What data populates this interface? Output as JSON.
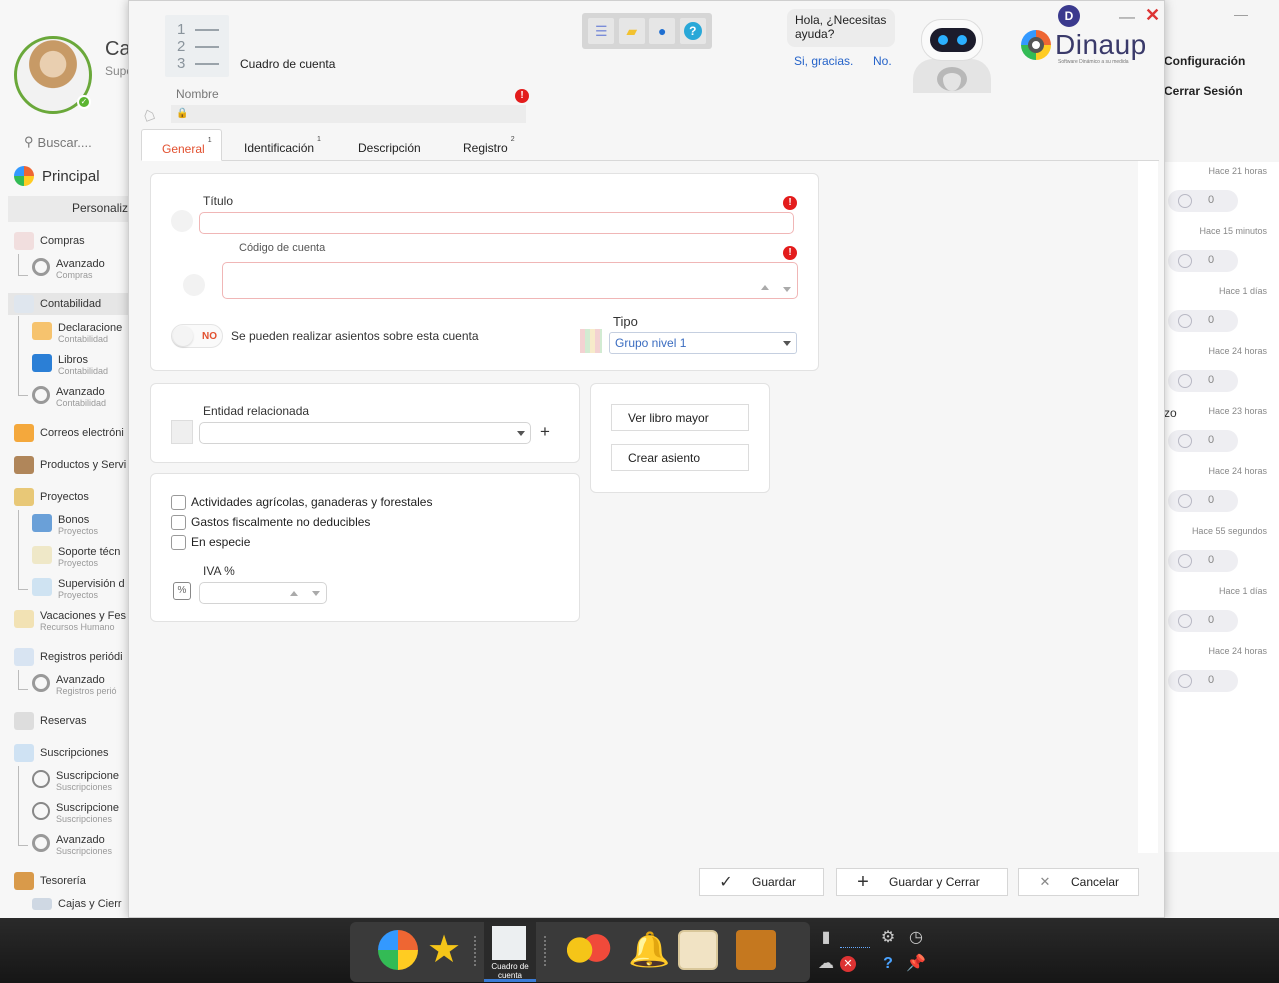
{
  "sidebar": {
    "user_name": "Ca",
    "user_sub": "Supe",
    "search_placeholder": "Buscar....",
    "principal": "Principal",
    "personaliza": "Personaliz",
    "items": [
      {
        "label": "Compras"
      },
      {
        "label": "Avanzado",
        "sub": "Compras"
      },
      {
        "label": "Contabilidad"
      },
      {
        "label": "Declaracione",
        "sub": "Contabilidad"
      },
      {
        "label": "Libros",
        "sub": "Contabilidad"
      },
      {
        "label": "Avanzado",
        "sub": "Contabilidad"
      },
      {
        "label": "Correos electróni"
      },
      {
        "label": "Productos y Servi"
      },
      {
        "label": "Proyectos"
      },
      {
        "label": "Bonos",
        "sub": "Proyectos"
      },
      {
        "label": "Soporte técn",
        "sub": "Proyectos"
      },
      {
        "label": "Supervisión d",
        "sub": "Proyectos"
      },
      {
        "label": "Vacaciones y Fes",
        "sub": "Recursos Humano"
      },
      {
        "label": "Registros periódi"
      },
      {
        "label": "Avanzado",
        "sub": "Registros perió"
      },
      {
        "label": "Reservas"
      },
      {
        "label": "Suscripciones"
      },
      {
        "label": "Suscripcione",
        "sub": "Suscripciones"
      },
      {
        "label": "Suscripcione",
        "sub": "Suscripciones"
      },
      {
        "label": "Avanzado",
        "sub": "Suscripciones"
      },
      {
        "label": "Tesorería"
      },
      {
        "label": "Cajas y Cierr"
      }
    ]
  },
  "right_panel": {
    "configuracion": "Configuración",
    "cerrar_sesion": "Cerrar Sesión",
    "fragment": "zo",
    "notifications": [
      {
        "time": "Hace 21 horas",
        "count": "0"
      },
      {
        "time": "Hace 15 minutos",
        "count": "0"
      },
      {
        "time": "Hace 1 días",
        "count": "0"
      },
      {
        "time": "Hace 24 horas",
        "count": "0"
      },
      {
        "time": "Hace 23 horas",
        "count": "0"
      },
      {
        "time": "Hace 24 horas",
        "count": "0"
      },
      {
        "time": "Hace 55 segundos",
        "count": "0"
      },
      {
        "time": "Hace 1 días",
        "count": "0"
      },
      {
        "time": "Hace 24 horas",
        "count": "0"
      }
    ]
  },
  "dialog": {
    "title": "Cuadro de cuenta",
    "doc_numbers": [
      "1",
      "2",
      "3"
    ],
    "nombre_label": "Nombre",
    "error_mark": "!",
    "assistant": {
      "question": "Hola, ¿Necesitas ayuda?",
      "yes": "Si, gracias.",
      "no": "No."
    },
    "logo": {
      "badge": "D",
      "text": "Dinaup",
      "tagline": "Software Dinámico a su medida"
    },
    "window": {
      "minimize": "—",
      "close": "✕"
    },
    "toolbar_icons": [
      "list-icon",
      "folder-icon",
      "chat-icon",
      "help-icon"
    ],
    "tabs": [
      {
        "label": "General",
        "badge": "1"
      },
      {
        "label": "Identificación",
        "badge": "1"
      },
      {
        "label": "Descripción",
        "badge": ""
      },
      {
        "label": "Registro",
        "badge": "2"
      }
    ],
    "general": {
      "titulo_label": "Título",
      "codigo_label": "Código de cuenta",
      "toggle_state": "NO",
      "toggle_label": "Se pueden realizar asientos sobre esta cuenta",
      "tipo_label": "Tipo",
      "tipo_value": "Grupo nivel 1",
      "entidad_label": "Entidad relacionada",
      "add_symbol": "+",
      "ver_libro": "Ver libro mayor",
      "crear_asiento": "Crear asiento",
      "checkboxes": [
        {
          "label": "Actividades agrícolas, ganaderas y forestales",
          "checked": false
        },
        {
          "label": "Gastos fiscalmente no deducibles",
          "checked": false
        },
        {
          "label": "En especie",
          "checked": false
        }
      ],
      "iva_label": "IVA %",
      "pct_symbol": "%"
    },
    "footer": {
      "guardar": "Guardar",
      "guardar_cerrar": "Guardar y Cerrar",
      "cancelar": "Cancelar"
    }
  },
  "taskbar": {
    "active_caption": "Cuadro de cuenta"
  }
}
